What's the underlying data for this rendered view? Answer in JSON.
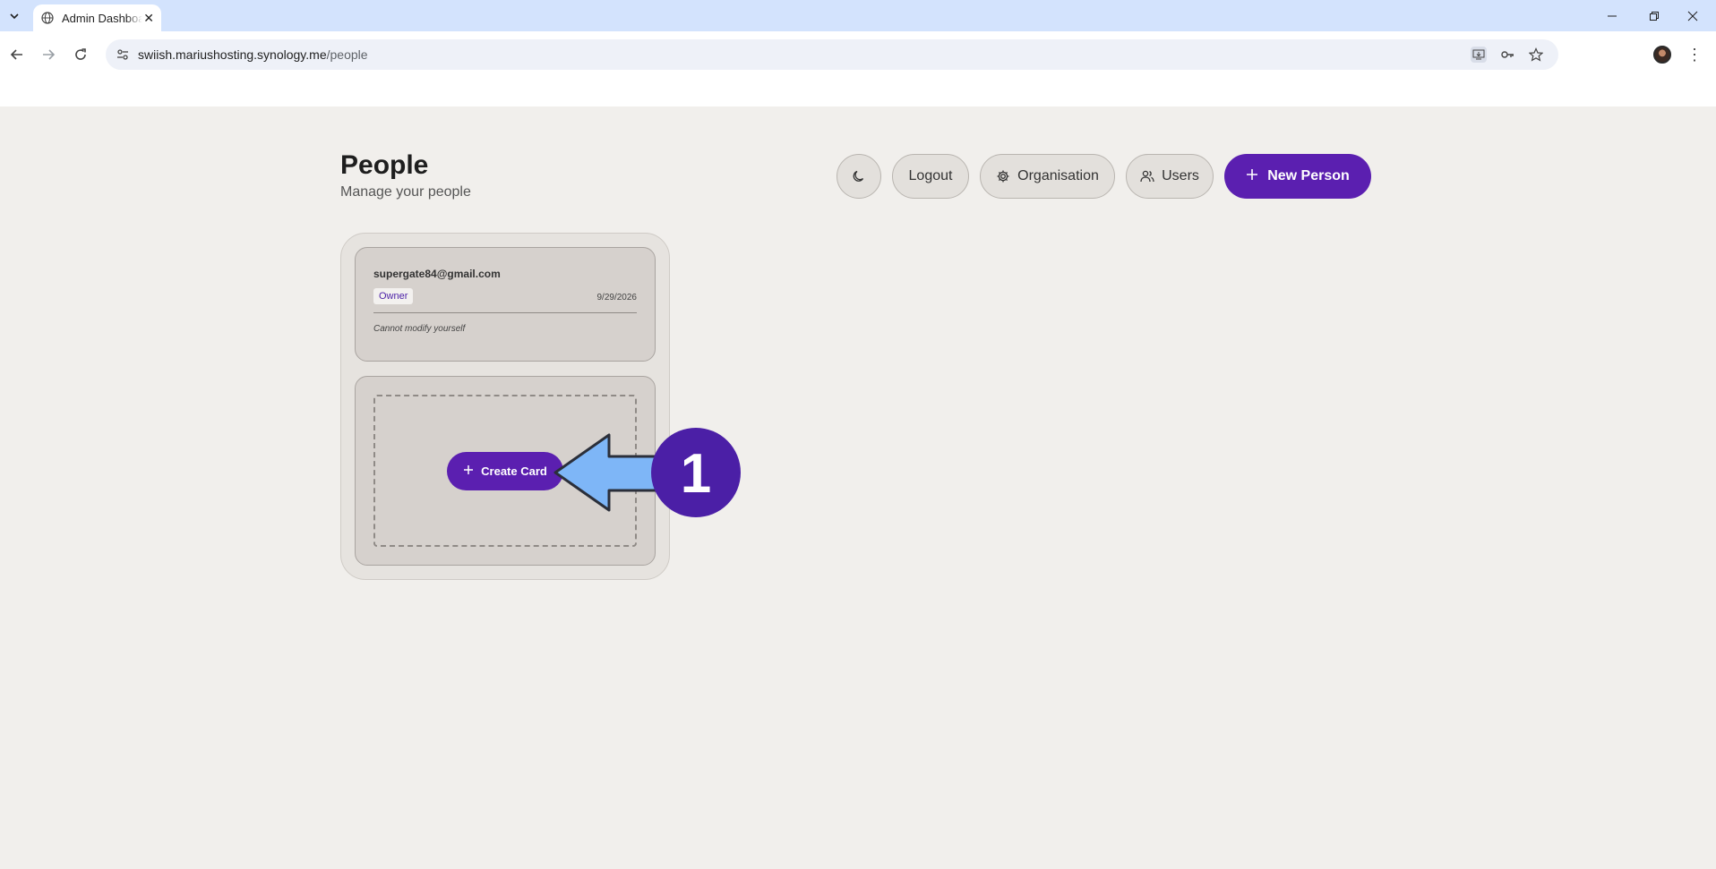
{
  "browser": {
    "tab_title": "Admin Dashboard",
    "url_host": "swiish.mariushosting.synology.me",
    "url_path": "/people"
  },
  "page": {
    "title": "People",
    "subtitle": "Manage your people"
  },
  "header_actions": {
    "logout_label": "Logout",
    "organisation_label": "Organisation",
    "users_label": "Users",
    "new_person_label": "New Person"
  },
  "people": [
    {
      "email": "supergate84@gmail.com",
      "role": "Owner",
      "date": "9/29/2026",
      "note": "Cannot modify yourself"
    }
  ],
  "create_card": {
    "label": "Create Card"
  },
  "annotation": {
    "step_number": "1"
  },
  "colors": {
    "accent": "#5b1fb0",
    "arrow": "#7eb6f7",
    "tabbar": "#d3e3fd"
  }
}
